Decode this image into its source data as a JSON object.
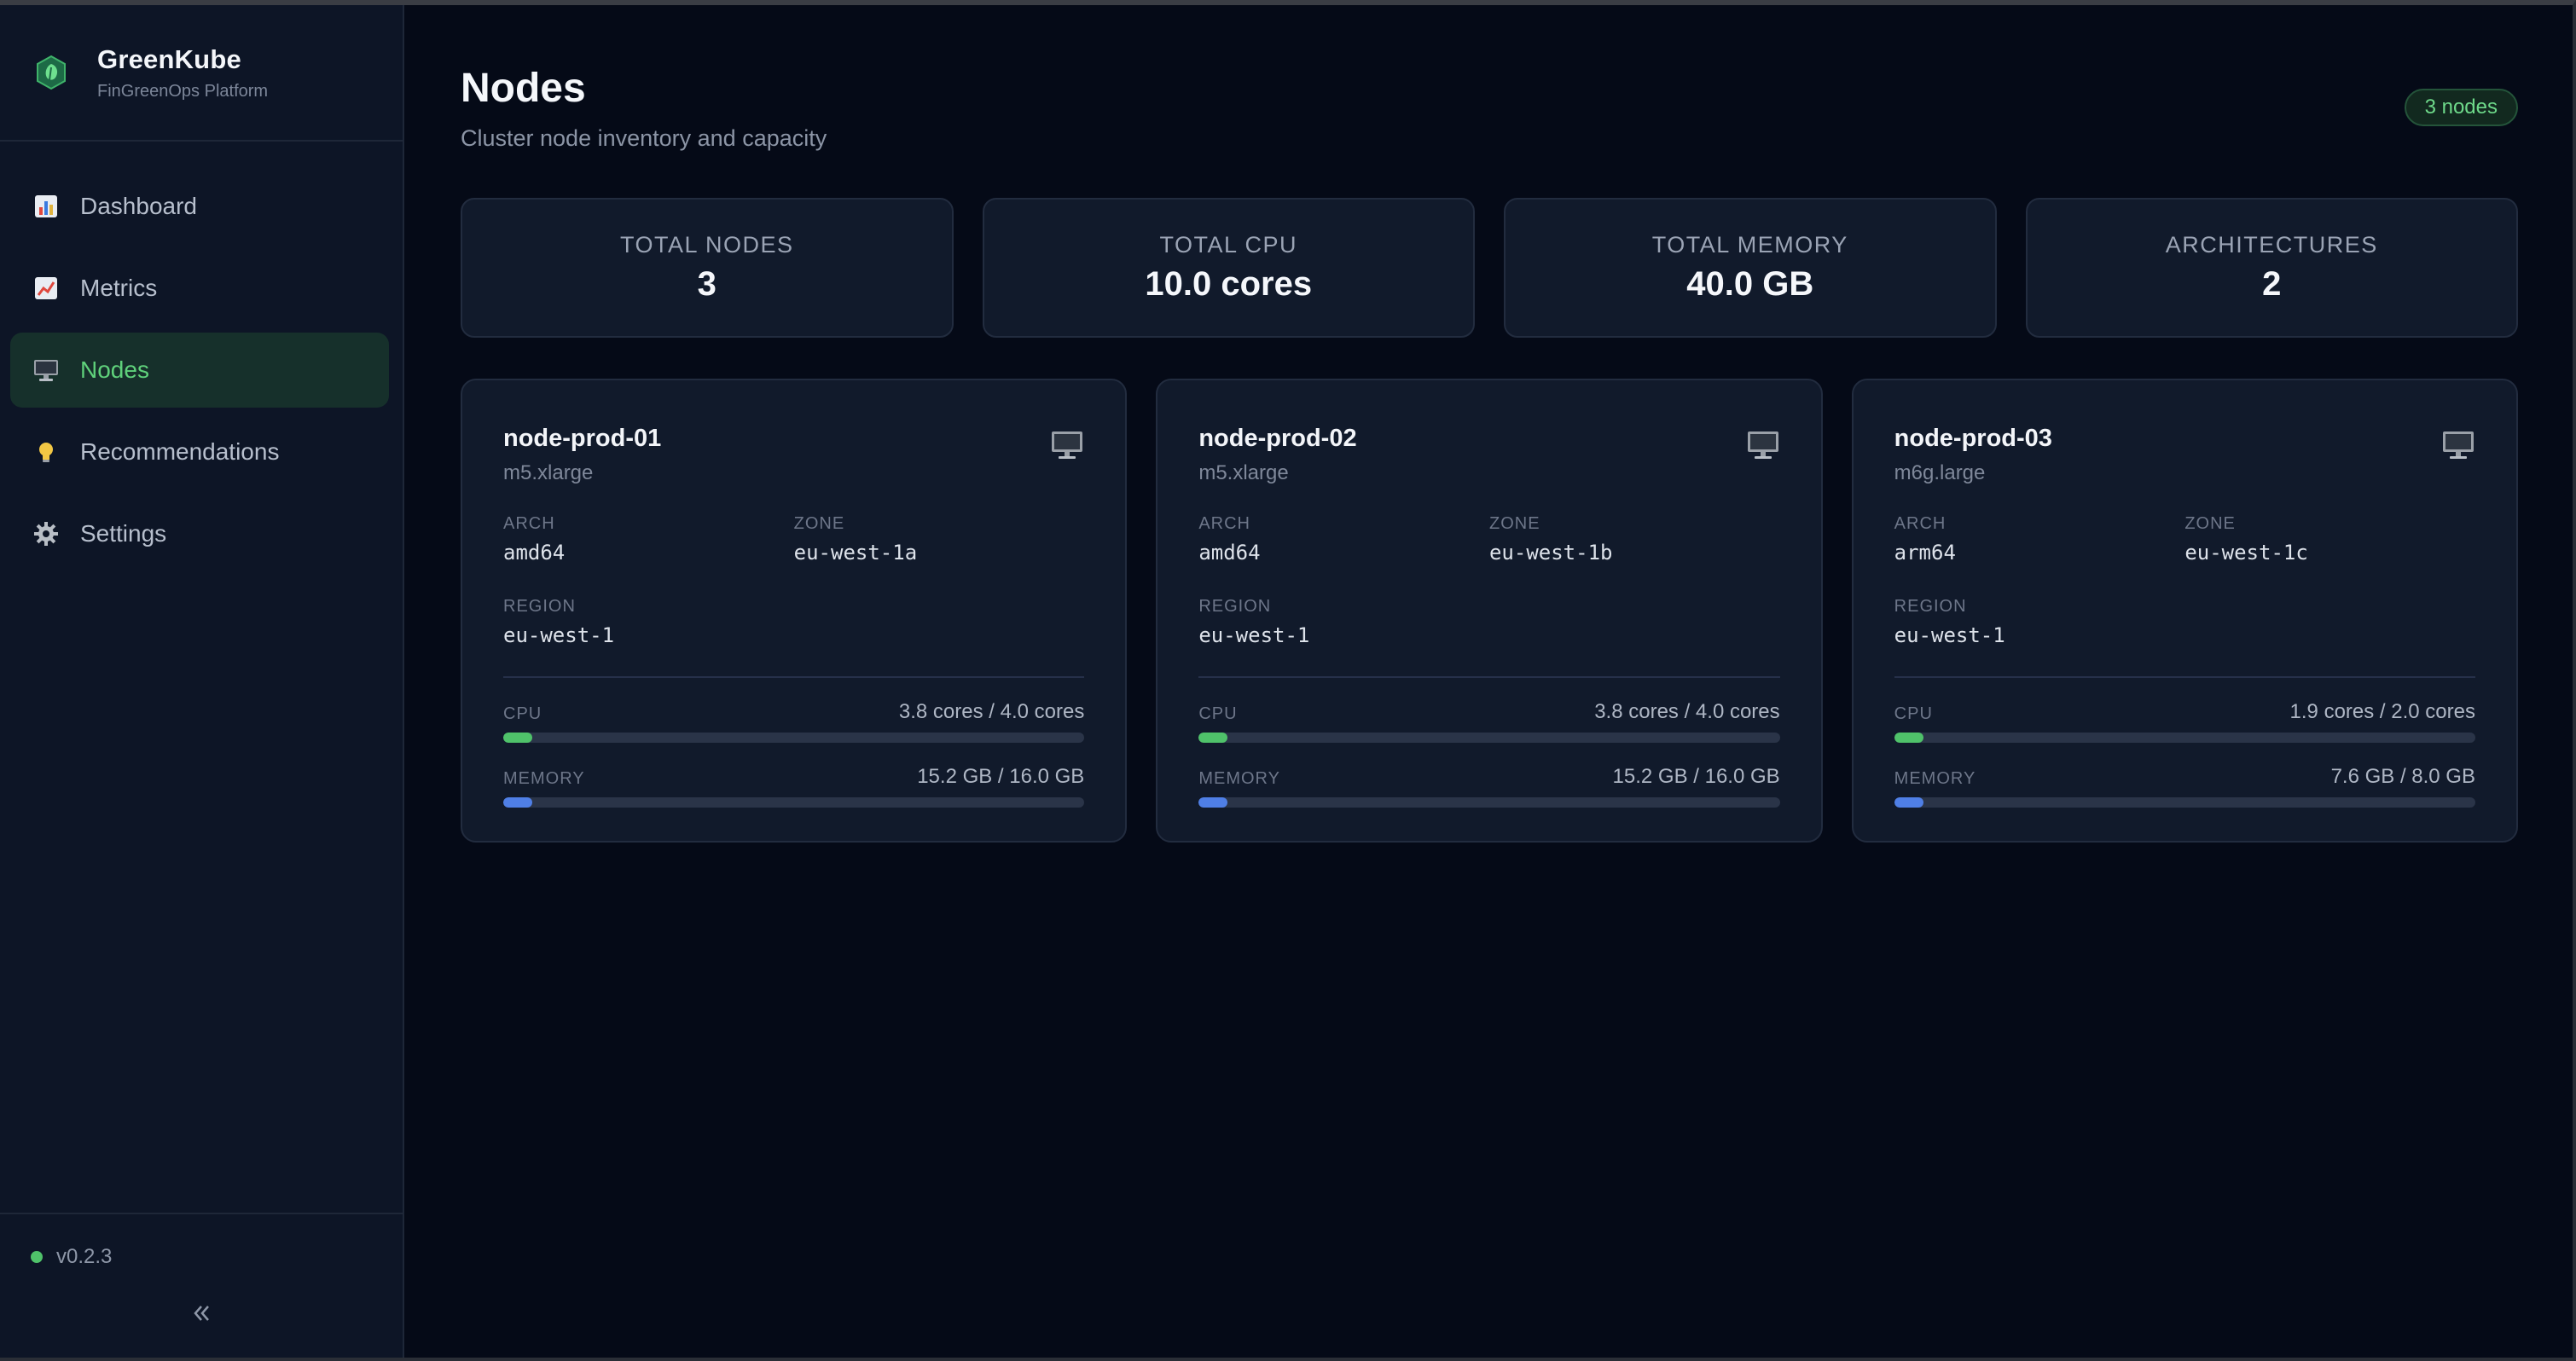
{
  "app": {
    "name": "GreenKube",
    "subtitle": "FinGreenOps Platform",
    "version": "v0.2.3"
  },
  "sidebar": {
    "items": [
      {
        "label": "Dashboard",
        "icon": "bar-chart-icon",
        "active": false
      },
      {
        "label": "Metrics",
        "icon": "line-chart-icon",
        "active": false
      },
      {
        "label": "Nodes",
        "icon": "computer-icon",
        "active": true
      },
      {
        "label": "Recommendations",
        "icon": "lightbulb-icon",
        "active": false
      },
      {
        "label": "Settings",
        "icon": "gear-icon",
        "active": false
      }
    ]
  },
  "page": {
    "title": "Nodes",
    "subtitle": "Cluster node inventory and capacity",
    "count_badge": "3 nodes"
  },
  "stats": [
    {
      "label": "TOTAL NODES",
      "value": "3"
    },
    {
      "label": "TOTAL CPU",
      "value": "10.0 cores"
    },
    {
      "label": "TOTAL MEMORY",
      "value": "40.0 GB"
    },
    {
      "label": "ARCHITECTURES",
      "value": "2"
    }
  ],
  "labels": {
    "arch": "ARCH",
    "zone": "ZONE",
    "region": "REGION",
    "cpu": "CPU",
    "memory": "MEMORY"
  },
  "nodes": [
    {
      "name": "node-prod-01",
      "instance_type": "m5.xlarge",
      "arch": "amd64",
      "zone": "eu-west-1a",
      "region": "eu-west-1",
      "cpu_text": "3.8 cores / 4.0 cores",
      "cpu_fill_pct": 5,
      "memory_text": "15.2 GB / 16.0 GB",
      "memory_fill_pct": 5
    },
    {
      "name": "node-prod-02",
      "instance_type": "m5.xlarge",
      "arch": "amd64",
      "zone": "eu-west-1b",
      "region": "eu-west-1",
      "cpu_text": "3.8 cores / 4.0 cores",
      "cpu_fill_pct": 5,
      "memory_text": "15.2 GB / 16.0 GB",
      "memory_fill_pct": 5
    },
    {
      "name": "node-prod-03",
      "instance_type": "m6g.large",
      "arch": "arm64",
      "zone": "eu-west-1c",
      "region": "eu-west-1",
      "cpu_text": "1.9 cores / 2.0 cores",
      "cpu_fill_pct": 5,
      "memory_text": "7.6 GB / 8.0 GB",
      "memory_fill_pct": 5
    }
  ],
  "colors": {
    "accent_green": "#4fc26a",
    "accent_blue": "#4f7fe6",
    "background": "#050a17",
    "sidebar": "#0d1526"
  }
}
